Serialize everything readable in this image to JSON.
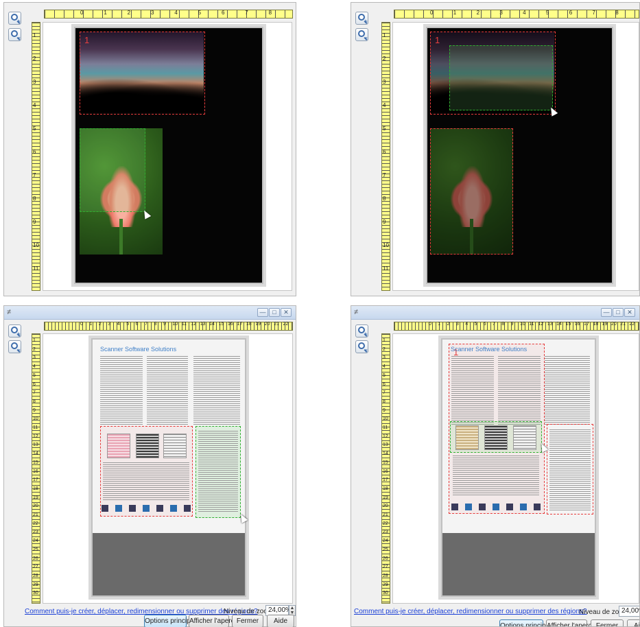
{
  "window": {
    "title_icon": "≠",
    "minimize_label": "—",
    "restore_label": "□",
    "close_label": "✕"
  },
  "icons": {
    "zoom_in": "magnifier-plus-icon",
    "zoom_out": "magnifier-minus-icon"
  },
  "ruler": {
    "top_ticks_short": [
      "0",
      "1",
      "2",
      "3",
      "4",
      "5",
      "6",
      "7",
      "8"
    ],
    "left_ticks_short": [
      "1",
      "2",
      "3",
      "4",
      "5",
      "6",
      "7",
      "8",
      "9",
      "10",
      "11"
    ],
    "top_ticks_long": [
      "0",
      "1",
      "2",
      "3",
      "4",
      "5",
      "6",
      "7",
      "8",
      "9",
      "10",
      "11",
      "12",
      "13",
      "14",
      "15",
      "16",
      "17",
      "18",
      "19",
      "20",
      "21",
      "22"
    ],
    "left_ticks_long": [
      "1",
      "2",
      "3",
      "4",
      "5",
      "6",
      "7",
      "8",
      "9",
      "10",
      "11",
      "12",
      "13",
      "14",
      "15",
      "16",
      "17",
      "18",
      "19",
      "20",
      "21",
      "22",
      "23",
      "24",
      "25",
      "26",
      "27",
      "28",
      "29",
      "30"
    ]
  },
  "regions": {
    "number_label": "1"
  },
  "document": {
    "title": "Scanner Software Solutions"
  },
  "status_bar": {
    "help_link": "Comment puis-je créer, déplacer, redimensionner ou supprimer des régions?",
    "zoom_label": "Niveau de zoom :",
    "zoom_value": "24,00%",
    "spin_up": "▲",
    "spin_down": "▼"
  },
  "buttons": {
    "main_options": "Options principal",
    "preview": "Afficher l'aperçu",
    "close": "Fermer",
    "help": "Aide"
  },
  "colors": {
    "region_selected": "#e63a3a",
    "region_active": "#2fb02f",
    "ruler": "#ffff8a",
    "link": "#1a3fd6"
  }
}
